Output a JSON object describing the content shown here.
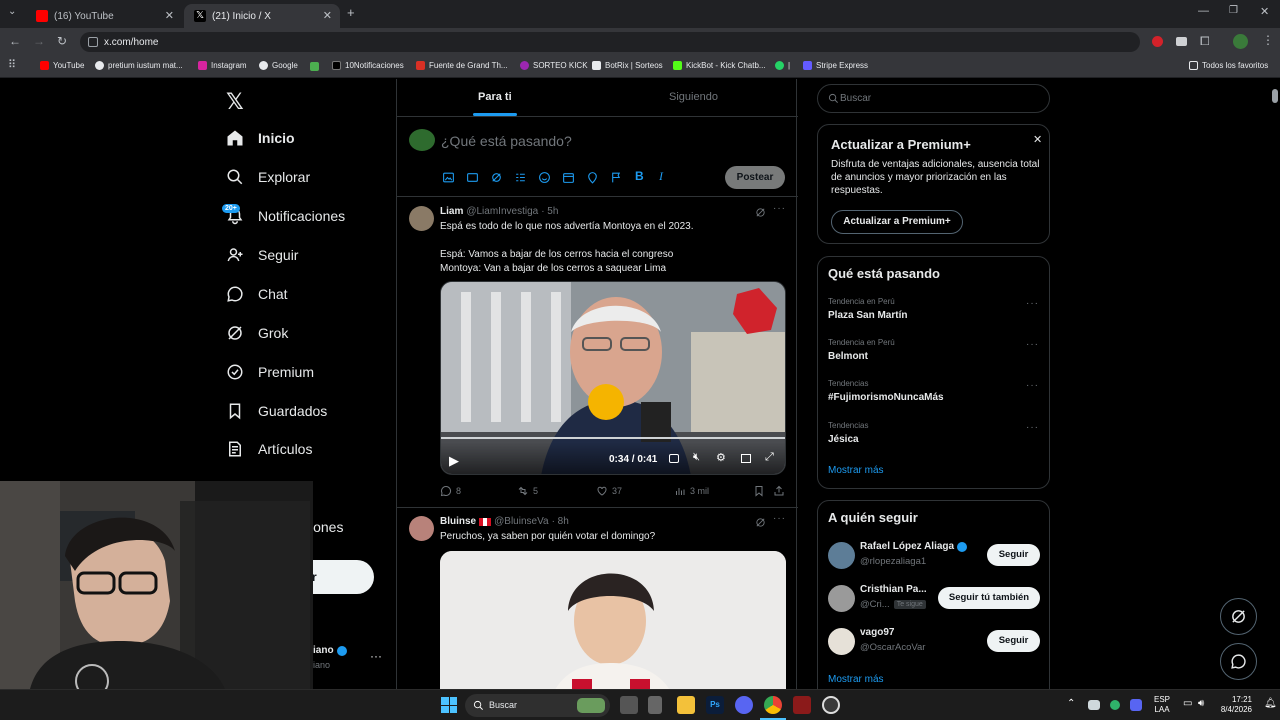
{
  "browser": {
    "tabs": [
      {
        "label": "(16) YouTube"
      },
      {
        "label": "(21) Inicio / X"
      }
    ],
    "url": "x.com/home",
    "bookmarks": [
      "YouTube",
      "pretium iustum mat...",
      "Instagram",
      "Google",
      "10Notificaciones",
      "Fuente de Grand Th...",
      "SORTEO KICK",
      "BotRix | Sorteos",
      "KickBot - Kick Chatb...",
      "|",
      "Stripe Express"
    ],
    "all_bookmarks": "Todos los favoritos"
  },
  "nav": {
    "items": [
      {
        "label": "Inicio",
        "icon": "home-icon"
      },
      {
        "label": "Explorar",
        "icon": "search-icon"
      },
      {
        "label": "Notificaciones",
        "icon": "bell-icon",
        "badge": "20+"
      },
      {
        "label": "Seguir",
        "icon": "person-add-icon"
      },
      {
        "label": "Chat",
        "icon": "chat-icon"
      },
      {
        "label": "Grok",
        "icon": "grok-icon"
      },
      {
        "label": "Premium",
        "icon": "verified-icon"
      },
      {
        "label": "Guardados",
        "icon": "bookmark-icon"
      },
      {
        "label": "Artículos",
        "icon": "article-icon"
      }
    ],
    "partial_item": "iones",
    "partial_button": "r",
    "profile_partial_name": "iano",
    "profile_partial_handle": "iano"
  },
  "timeline": {
    "tabs": [
      "Para ti",
      "Siguiendo"
    ],
    "composer_placeholder": "¿Qué está pasando?",
    "post_button": "Postear",
    "tweets": [
      {
        "name": "Liam",
        "handle": "@LiamInvestiga",
        "time": "· 5h",
        "text": "Espá es todo de lo que nos advertía Montoya en el 2023.\n\nEspá: Vamos a bajar de los cerros hacia el congreso\nMontoya: Van a bajar de los cerros a saquear Lima",
        "video_time": "0:34 / 0:41",
        "replies": "8",
        "reposts": "5",
        "likes": "37",
        "views": "3 mil"
      },
      {
        "name": "Bluinse",
        "handle": "@BluinseVa",
        "time": "· 8h",
        "text": "Peruchos, ya saben por quién votar el domingo?"
      }
    ]
  },
  "right": {
    "search_placeholder": "Buscar",
    "premium": {
      "title": "Actualizar a Premium+",
      "body": "Disfruta de ventajas adicionales, ausencia total de anuncios y mayor priorización en las respuestas.",
      "button": "Actualizar a Premium+"
    },
    "trends_title": "Qué está pasando",
    "trends": [
      {
        "meta": "Tendencia en Perú",
        "name": "Plaza San Martín"
      },
      {
        "meta": "Tendencia en Perú",
        "name": "Belmont"
      },
      {
        "meta": "Tendencias",
        "name": "#FujimorismoNuncaMás"
      },
      {
        "meta": "Tendencias",
        "name": "Jésica"
      }
    ],
    "show_more": "Mostrar más",
    "follow_title": "A quién seguir",
    "follow": [
      {
        "name": "Rafael López Aliaga",
        "handle": "@rlopezaliaga1",
        "button": "Seguir",
        "verified": true
      },
      {
        "name": "Cristhian Pa...",
        "handle": "@Cri...",
        "tag": "Te sigue",
        "button": "Seguir tú también"
      },
      {
        "name": "vago97",
        "handle": "@OscarAcoVar",
        "button": "Seguir"
      }
    ],
    "follow_show_more": "Mostrar más"
  },
  "taskbar": {
    "search": "Buscar",
    "lang": "ESP",
    "lang2": "LAA",
    "time": "17:21",
    "date": "8/4/2026"
  },
  "colors": {
    "accent": "#1d9bf0",
    "bg": "#000000",
    "border": "#2f3336",
    "muted": "#71767b"
  }
}
